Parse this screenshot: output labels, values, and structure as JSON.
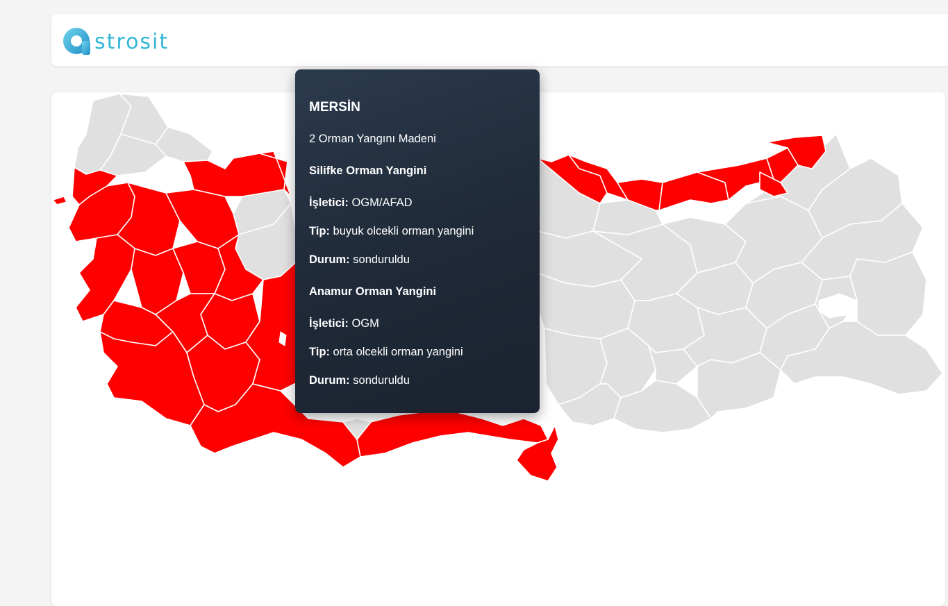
{
  "brand": {
    "name": "strosit",
    "accent": "#33b6d6"
  },
  "colors": {
    "fire": "#ff0000",
    "no_fire": "#e0e0e0"
  },
  "tooltip": {
    "province": "MERSİN",
    "summary": "2 Orman Yangını Madeni",
    "fires": [
      {
        "name": "Silifke Orman Yangini",
        "operator_label": "İşletici:",
        "operator": "OGM/AFAD",
        "type_label": "Tip:",
        "type": "buyuk olcekli orman yangini",
        "status_label": "Durum:",
        "status": "sonduruldu"
      },
      {
        "name": "Anamur Orman Yangini",
        "operator_label": "İşletici:",
        "operator": "OGM",
        "type_label": "Tip:",
        "type": "orta olcekli orman yangini",
        "status_label": "Durum:",
        "status": "sonduruldu"
      }
    ]
  }
}
